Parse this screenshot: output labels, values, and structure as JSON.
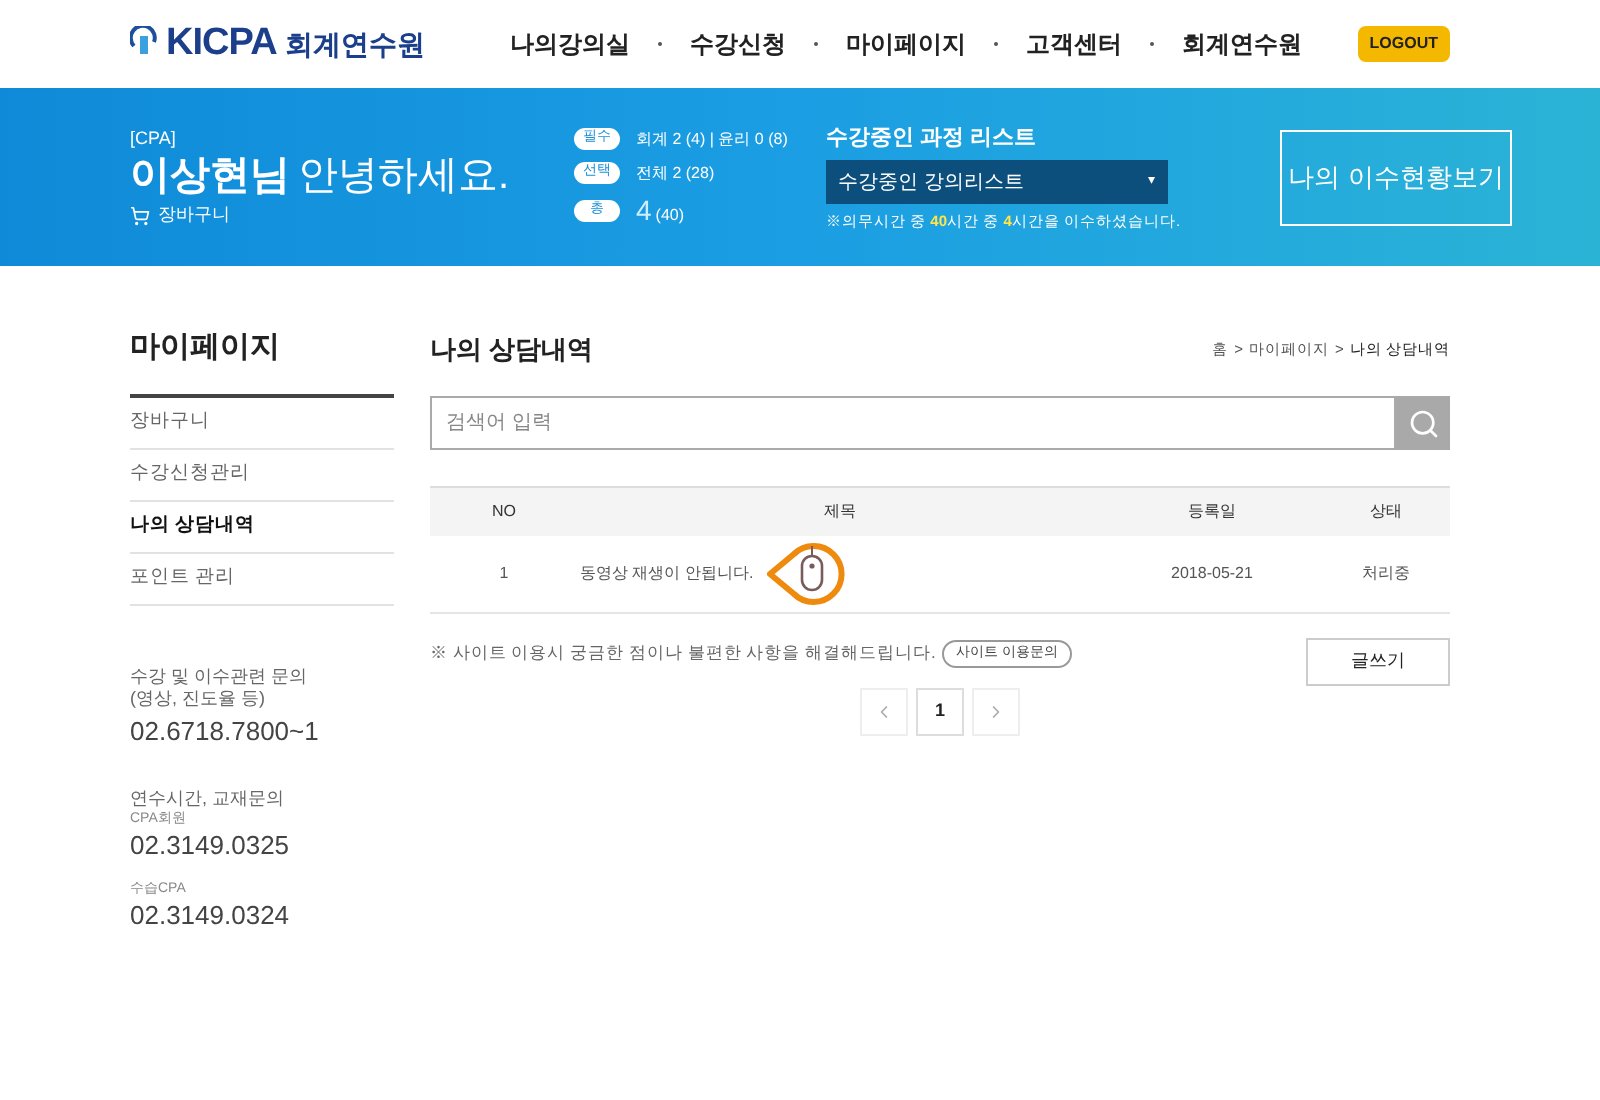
{
  "logo": {
    "brand": "KICPA",
    "name": "회계연수원"
  },
  "nav": [
    {
      "label": "나의강의실"
    },
    {
      "label": "수강신청"
    },
    {
      "label": "마이페이지"
    },
    {
      "label": "고객센터"
    },
    {
      "label": "회계연수원"
    }
  ],
  "logout": "LOGOUT",
  "banner": {
    "tag": "[CPA]",
    "name": "이상현님",
    "greeting": "안녕하세요.",
    "cart": "장바구니",
    "stats": [
      {
        "badge": "필수",
        "text": "회계 2 (4) | 윤리 0 (8)",
        "kind": "small"
      },
      {
        "badge": "선택",
        "text": "전체 2 (28)",
        "kind": "small"
      },
      {
        "badge": "총",
        "text": "4",
        "sub": "(40)",
        "kind": "big"
      }
    ],
    "course_list": {
      "title": "수강중인 과정 리스트",
      "value": "수강중인 강의리스트",
      "caret": "▾",
      "note": "※의무시간 중 **40**시간 중 **4**시간을 이수하셨습니다."
    },
    "status_button": "나의 이수현황보기"
  },
  "sidebar": {
    "title": "마이페이지",
    "items": [
      {
        "label": "장바구니",
        "selected": false
      },
      {
        "label": "수강신청관리",
        "selected": false
      },
      {
        "label": "나의 상담내역",
        "selected": true
      },
      {
        "label": "포인트 관리",
        "selected": false
      }
    ],
    "contacts": [
      {
        "label": "수강 및 이수관련 문의\n(영상, 진도율 등)",
        "number": "02.6718.7800~1"
      },
      {
        "label": "연수시간, 교재문의",
        "sublabel": "CPA회원",
        "number": "02.3149.0325"
      },
      {
        "sublabel": "수습CPA",
        "number": "02.3149.0324"
      }
    ]
  },
  "page": {
    "title": "나의 상담내역",
    "breadcrumb": [
      {
        "label": "홈"
      },
      {
        "label": "마이페이지"
      },
      {
        "label": "나의 상담내역"
      }
    ],
    "separator": ">"
  },
  "search": {
    "placeholder": "검색어 입력"
  },
  "table": {
    "columns": [
      "NO",
      "제목",
      "등록일",
      "상태"
    ],
    "rows": [
      {
        "no": "1",
        "title": "동영상 재생이 안됩니다.",
        "date": "2018-05-21",
        "status": "처리중"
      }
    ]
  },
  "notice": "※ 사이트 이용시 궁금한 점이나 불편한 사항을 해결해드립니다.",
  "inquiry_button": "사이트 이용문의",
  "write_button": "글쓰기",
  "pagination": {
    "pages": [
      {
        "label": "1",
        "selected": true
      }
    ]
  }
}
